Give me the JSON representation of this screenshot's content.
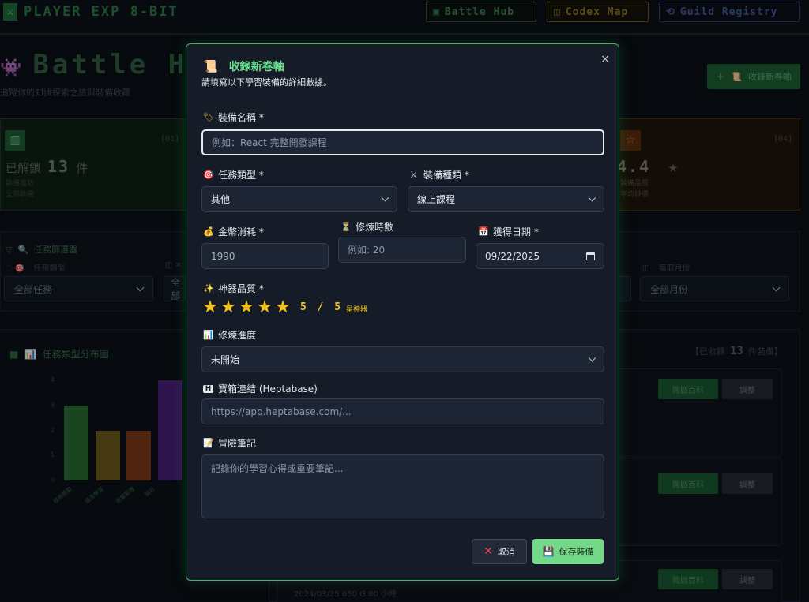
{
  "app": {
    "brand": "PLAYER EXP 8-BIT",
    "nav": [
      {
        "icon": "▣",
        "label": "Battle Hub"
      },
      {
        "icon": "◫",
        "label": "Codex Map"
      },
      {
        "icon": "⟲",
        "label": "Guild Registry"
      }
    ]
  },
  "background": {
    "page_title": "Battle H",
    "page_subtitle": "追蹤你的知識探索之旅與裝備收藏",
    "add_button": "收錄新卷軸",
    "stats": {
      "left": {
        "tag": "[01]",
        "label": "已解鎖",
        "value": "13",
        "unit": "件",
        "line1": "裝備獲取",
        "line2": "全部裝備"
      },
      "right": {
        "tag": "[04]",
        "value": "4.4",
        "line1": "裝備品質",
        "line2": "平均評價"
      }
    },
    "filters": {
      "title": "任務篩選器",
      "label_type": "任務類型",
      "label_month": "獲取月份",
      "select_type": "全部任務",
      "select_second": "全部",
      "select_month": "全部月份"
    },
    "chart": {
      "title": "任務類型分布圖"
    },
    "list": {
      "count_prefix": "【已收錄",
      "count_value": "13",
      "count_suffix": "件裝備】",
      "open_label": "開啟百科",
      "edit_label": "調整",
      "meta": "2024/03/25   650 G   80 小時"
    }
  },
  "chart_data": {
    "type": "bar",
    "categories": [
      "技術開發",
      "語言學習",
      "商業管理",
      "設計"
    ],
    "values": [
      3,
      2,
      2,
      4
    ],
    "ylim": [
      0,
      4
    ],
    "yticks": [
      0,
      1,
      2,
      3,
      4
    ],
    "colors": [
      "#2a6a34",
      "#6a5a1c",
      "#7a3a1c",
      "#4a1f78"
    ]
  },
  "modal": {
    "title": "收錄新卷軸",
    "description": "請填寫以下學習裝備的詳細數據。",
    "close": "×",
    "name": {
      "label": "裝備名稱 *",
      "placeholder": "例如：React 完整開發課程"
    },
    "task_type": {
      "label": "任務類型 *",
      "value": "其他"
    },
    "equipment_type": {
      "label": "裝備種類 *",
      "value": "線上課程"
    },
    "coin_cost": {
      "label": "金幣消耗 *",
      "value": "1990"
    },
    "hours": {
      "label": "修煉時數",
      "placeholder": "例如: 20"
    },
    "acquired_date": {
      "label": "獲得日期 *",
      "value": "09/22/2025"
    },
    "quality": {
      "label": "神器品質 *",
      "rating": 5,
      "max": 5,
      "rating_text": "5 / 5",
      "rating_label": "星神器"
    },
    "progress": {
      "label": "修煉進度",
      "value": "未開始"
    },
    "link": {
      "label": "寶箱連結 (Heptabase)",
      "placeholder": "https://app.heptabase.com/..."
    },
    "notes": {
      "label": "冒險筆記",
      "placeholder": "記錄你的學習心得或重要筆記..."
    },
    "cancel": "取消",
    "save": "保存裝備"
  }
}
